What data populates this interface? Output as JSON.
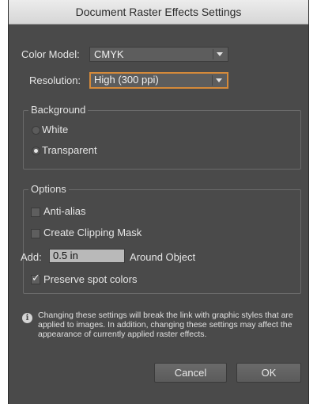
{
  "dialog": {
    "title": "Document Raster Effects Settings"
  },
  "color_model": {
    "label": "Color Model:",
    "value": "CMYK"
  },
  "resolution": {
    "label": "Resolution:",
    "value": "High (300 ppi)"
  },
  "background": {
    "legend": "Background",
    "options": [
      {
        "label": "White",
        "selected": false
      },
      {
        "label": "Transparent",
        "selected": true
      }
    ]
  },
  "options": {
    "legend": "Options",
    "anti_alias": {
      "label": "Anti-alias",
      "checked": false
    },
    "clipping_mask": {
      "label": "Create Clipping Mask",
      "checked": false
    },
    "add": {
      "label": "Add:",
      "value": "0.5 in",
      "suffix": "Around Object"
    },
    "preserve_spot": {
      "label": "Preserve spot colors",
      "checked": true
    }
  },
  "info": {
    "text": "Changing these settings will break the link with graphic styles that are applied to images. In addition, changing these settings may affect the appearance of currently applied raster effects."
  },
  "buttons": {
    "cancel": "Cancel",
    "ok": "OK"
  },
  "colors": {
    "panel": "#4a4a4a",
    "focus": "#d58a3a"
  }
}
